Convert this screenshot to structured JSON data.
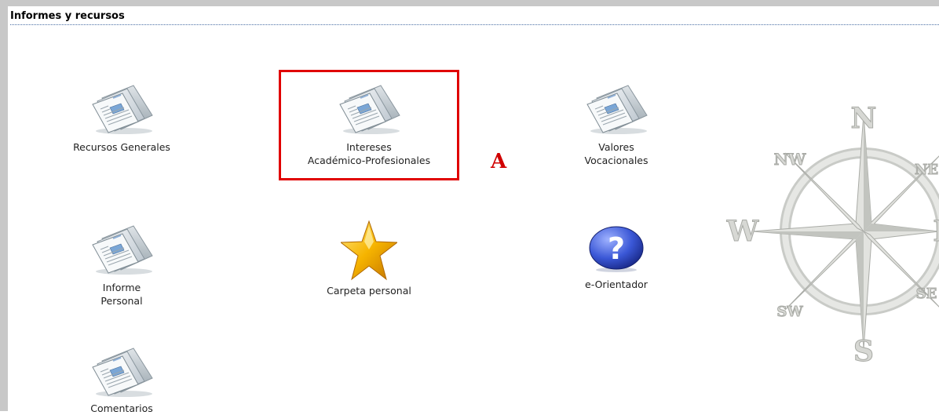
{
  "section": {
    "title": "Informes y recursos"
  },
  "items": [
    {
      "label": "Recursos Generales",
      "icon": "document-folder-icon"
    },
    {
      "label_line1": "Intereses",
      "label_line2": "Académico-Profesionales",
      "icon": "document-folder-icon"
    },
    {
      "label_line1": "Valores",
      "label_line2": "Vocacionales",
      "icon": "document-folder-icon"
    },
    {
      "label_line1": "Informe",
      "label_line2": "Personal",
      "icon": "document-folder-icon"
    },
    {
      "label": "Carpeta personal",
      "icon": "star-icon"
    },
    {
      "label": "e-Orientador",
      "icon": "help-icon"
    },
    {
      "label": "Comentarios",
      "icon": "document-folder-icon"
    }
  ],
  "annotation": {
    "marker": "A"
  },
  "compass": {
    "n": "N",
    "s": "S",
    "w": "W",
    "e": "E",
    "nw": "NW",
    "ne": "NE",
    "sw": "SW",
    "se": "SE"
  },
  "colors": {
    "highlight": "#e00000",
    "accent": "#4a6fa5"
  }
}
